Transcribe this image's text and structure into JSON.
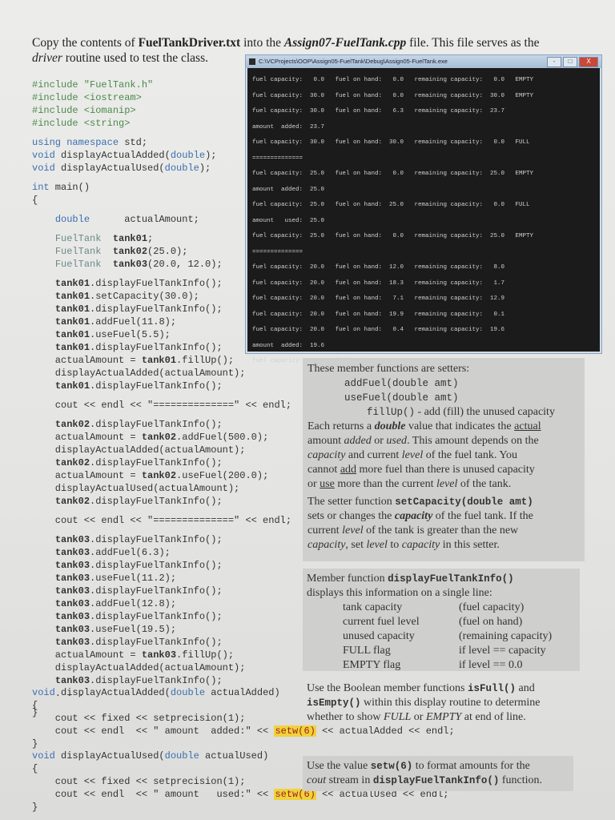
{
  "intro": {
    "pre": "Copy the contents of ",
    "file": "FuelTankDriver.txt",
    "mid": " into the ",
    "target": "Assign07-FuelTank.cpp",
    "post": " file.  This file serves as the",
    "line2_a": "driver",
    "line2_b": " routine used to test the class."
  },
  "code_top": [
    "#include \"FuelTank.h\"",
    "#include <iostream>",
    "#include <iomanip>",
    "#include <string>",
    "using namespace std;",
    "void displayActualAdded(double);",
    "void displayActualUsed(double);",
    "int main()",
    "{",
    "    double      actualAmount;",
    "    FuelTank  tank01;",
    "    FuelTank  tank02(25.0);",
    "    FuelTank  tank03(20.0, 12.0);",
    "    tank01.displayFuelTankInfo();",
    "    tank01.setCapacity(30.0);",
    "    tank01.displayFuelTankInfo();",
    "    tank01.addFuel(11.8);",
    "    tank01.useFuel(5.5);",
    "    tank01.displayFuelTankInfo();",
    "    actualAmount = tank01.fillUp();",
    "    displayActualAdded(actualAmount);",
    "    tank01.displayFuelTankInfo();",
    "    cout << endl << \"==============\" << endl;",
    "    tank02.displayFuelTankInfo();",
    "    actualAmount = tank02.addFuel(500.0);",
    "    displayActualAdded(actualAmount);",
    "    tank02.displayFuelTankInfo();",
    "    actualAmount = tank02.useFuel(200.0);",
    "    displayActualUsed(actualAmount);",
    "    tank02.displayFuelTankInfo();",
    "    cout << endl << \"==============\" << endl;",
    "    tank03.displayFuelTankInfo();",
    "    tank03.addFuel(6.3);",
    "    tank03.displayFuelTankInfo();",
    "    tank03.useFuel(11.2);",
    "    tank03.displayFuelTankInfo();",
    "    tank03.addFuel(12.8);",
    "    tank03.displayFuelTankInfo();",
    "    tank03.useFuel(19.5);",
    "    tank03.displayFuelTankInfo();",
    "    actualAmount = tank03.fillUp();",
    "    displayActualAdded(actualAmount);",
    "    tank03.displayFuelTankInfo();",
    "    . . .",
    "}"
  ],
  "code_added": [
    "void displayActualAdded(double actualAdded)",
    "{",
    "    cout << fixed << setprecision(1);",
    "    cout << endl  << \" amount  added:\" << setw(6) << actualAdded << endl;",
    "}"
  ],
  "code_used": [
    "void displayActualUsed(double actualUsed)",
    "{",
    "    cout << fixed << setprecision(1);",
    "    cout << endl  << \" amount   used:\" << setw(6) << actualUsed << endl;",
    "}"
  ],
  "console": {
    "title": "C:\\VCProjects\\OOP\\Assign05-FuelTank\\Debug\\Assign05-FuelTank.exe",
    "buttons": [
      "-",
      "□",
      "X"
    ],
    "rows": [
      "fuel capacity:   0.0   fuel on hand:   0.0   remaining capacity:   0.0   EMPTY",
      "fuel capacity:  30.0   fuel on hand:   0.0   remaining capacity:  30.0   EMPTY",
      "fuel capacity:  30.0   fuel on hand:   6.3   remaining capacity:  23.7",
      "amount  added:  23.7",
      "fuel capacity:  30.0   fuel on hand:  30.0   remaining capacity:   0.0   FULL",
      "==============",
      "fuel capacity:  25.0   fuel on hand:   0.0   remaining capacity:  25.0   EMPTY",
      "amount  added:  25.0",
      "fuel capacity:  25.0   fuel on hand:  25.0   remaining capacity:   0.0   FULL",
      "amount   used:  25.0",
      "fuel capacity:  25.0   fuel on hand:   0.0   remaining capacity:  25.0   EMPTY",
      "==============",
      "fuel capacity:  20.0   fuel on hand:  12.0   remaining capacity:   8.0",
      "fuel capacity:  20.0   fuel on hand:  18.3   remaining capacity:   1.7",
      "fuel capacity:  20.0   fuel on hand:   7.1   remaining capacity:  12.9",
      "fuel capacity:  20.0   fuel on hand:  19.9   remaining capacity:   0.1",
      "fuel capacity:  20.0   fuel on hand:   0.4   remaining capacity:  19.6",
      "amount  added:  19.6",
      "fuel capacity:  20.0   fuel on hand:  20.0   remaining capacity:   0.0   FULL"
    ]
  },
  "setters": {
    "intro": "These member functions are setters:",
    "add": "addFuel(double amt)",
    "use": "useFuel(double  amt)",
    "fill": "fillUp()",
    "fill_desc": "  -  add (fill) the unused capacity",
    "p1_a": "Each returns a ",
    "p1_b": "double",
    "p1_c": " value that indicates the ",
    "p1_d": "actual",
    "p2_a": "amount ",
    "p2_b": "added",
    "p2_c": " or ",
    "p2_d": "used",
    "p2_e": ".  This amount depends on the",
    "p3_a": "capacity",
    "p3_b": " and current ",
    "p3_c": "level",
    "p3_d": " of the fuel tank.  You",
    "p4_a": "cannot ",
    "p4_b": "add",
    "p4_c": " more fuel than there is unused capacity",
    "p5_a": "or ",
    "p5_b": "use",
    "p5_c": " more than the current ",
    "p5_d": "level",
    "p5_e": " of the tank.",
    "s1_a": "The setter function ",
    "s1_b": "setCapacity(double amt)",
    "s2_a": "sets or changes the ",
    "s2_b": "capacity",
    "s2_c": " of the fuel tank.  If the",
    "s3_a": "current ",
    "s3_b": "level",
    "s3_c": " of the tank is greater than the new",
    "s4_a": "capacity",
    "s4_b": ", set ",
    "s4_c": "level",
    "s4_d": " to ",
    "s4_e": "capacity",
    "s4_f": " in this setter."
  },
  "display_note": {
    "l1_a": "Member function ",
    "l1_b": "displayFuelTankInfo()",
    "l2": "displays this information on a single line:",
    "pairs": [
      [
        "tank capacity",
        "(fuel capacity)"
      ],
      [
        "current fuel level",
        "(fuel on hand)"
      ],
      [
        "unused capacity",
        "(remaining capacity)"
      ],
      [
        "FULL    flag",
        "if level == capacity"
      ],
      [
        "EMPTY flag",
        "if level == 0.0"
      ]
    ],
    "b1_a": "Use the Boolean member functions ",
    "b1_b": "isFull()",
    "b1_c": " and",
    "b2_a": "isEmpty()",
    "b2_b": " within this display routine to determine",
    "b3_a": "whether to show ",
    "b3_b": "FULL",
    "b3_c": " or ",
    "b3_d": "EMPTY",
    "b3_e": " at end of line."
  },
  "setw_note": {
    "l1_a": "Use the value ",
    "l1_b": "setw(6)",
    "l1_c": " to format amounts for the",
    "l2_a": "cout",
    "l2_b": " stream in ",
    "l2_c": "displayFuelTankInfo()",
    "l2_d": " function."
  }
}
